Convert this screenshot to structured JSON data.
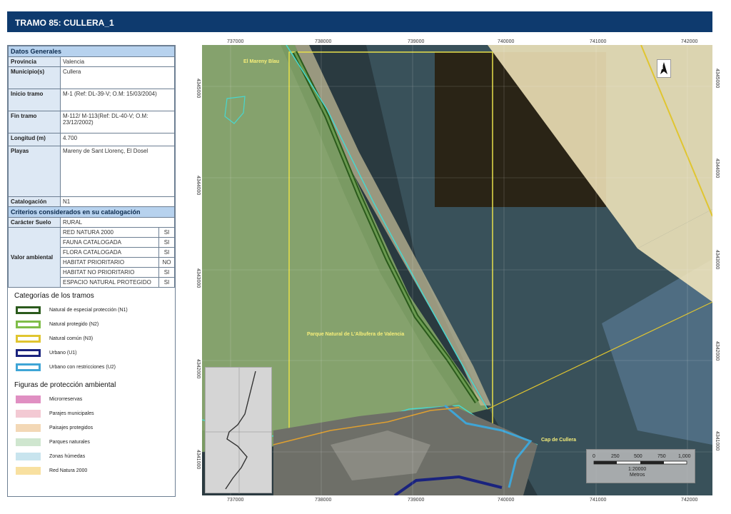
{
  "title": "TRAMO 85: CULLERA_1",
  "datos": {
    "header": "Datos Generales",
    "rows": [
      {
        "label": "Provincia",
        "value": "Valencia"
      },
      {
        "label": "Municipio(s)",
        "value": "Cullera"
      },
      {
        "label": "Inicio tramo",
        "value": "M-1 (Ref: DL-39-V; O.M: 15/03/2004)"
      },
      {
        "label": "Fin tramo",
        "value": "M-112/ M-113(Ref: DL-40-V; O.M: 23/12/2002)"
      },
      {
        "label": "Longitud (m)",
        "value": "4.700"
      },
      {
        "label": "Playas",
        "value": "Mareny de Sant Llorenç, El Dosel"
      },
      {
        "label": "Catalogación",
        "value": "N1"
      }
    ]
  },
  "criterios": {
    "header": "Criterios considerados en su catalogación",
    "caracter_label": "Carácter Suelo",
    "caracter_value": "RURAL",
    "valor_label": "Valor ambiental",
    "items": [
      {
        "name": "RED NATURA 2000",
        "flag": "SI"
      },
      {
        "name": "FAUNA CATALOGADA",
        "flag": "SI"
      },
      {
        "name": "FLORA CATALOGADA",
        "flag": "SI"
      },
      {
        "name": "HABITAT PRIORITARIO",
        "flag": "NO"
      },
      {
        "name": "HABITAT NO PRIORITARIO",
        "flag": "SI"
      },
      {
        "name": "ESPACIO NATURAL PROTEGIDO",
        "flag": "SI"
      }
    ]
  },
  "legend_tramos": {
    "title": "Categorías de los tramos",
    "items": [
      {
        "label": "Natural de especial protección (N1)",
        "color": "#2b5a1c"
      },
      {
        "label": "Natural protegido (N2)",
        "color": "#7fbd48"
      },
      {
        "label": "Natural común (N3)",
        "color": "#e0c530"
      },
      {
        "label": "Urbano (U1)",
        "color": "#1a237e"
      },
      {
        "label": "Urbano con restricciones (U2)",
        "color": "#3fa5d6"
      }
    ]
  },
  "legend_figuras": {
    "title": "Figuras de protección ambiental",
    "items": [
      {
        "label": "Microrreservas",
        "color": "#e08fc2"
      },
      {
        "label": "Parajes municipales",
        "color": "#f3c9d3"
      },
      {
        "label": "Paisajes protegidos",
        "color": "#f3d8b6"
      },
      {
        "label": "Parques naturales",
        "color": "#cfe6cf"
      },
      {
        "label": "Zonas húmedas",
        "color": "#c8e4ee"
      },
      {
        "label": "Red Natura 2000",
        "color": "#f8e0a0"
      }
    ]
  },
  "map": {
    "x_ticks": [
      "737000",
      "738000",
      "739000",
      "740000",
      "741000",
      "742000"
    ],
    "y_ticks": [
      "4345000",
      "4344000",
      "4343000",
      "4342000",
      "4341000"
    ],
    "labels": {
      "mareny": "El Mareny Blau",
      "parque": "Parque Natural de L'Albufera de Valencia",
      "cap": "Cap de Cullera"
    },
    "north": "N",
    "scale": {
      "ticks": [
        "0",
        "250",
        "500",
        "750",
        "1,000"
      ],
      "ratio": "1:20000",
      "unit": "Metros"
    }
  }
}
